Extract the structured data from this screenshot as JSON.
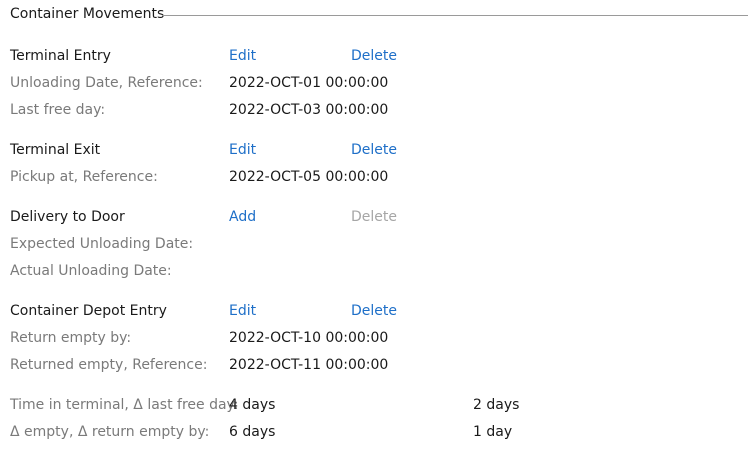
{
  "section": {
    "title": "Container Movements"
  },
  "terminal_entry": {
    "heading": "Terminal Entry",
    "edit_label": "Edit",
    "delete_label": "Delete",
    "unloading_label": "Unloading Date, Reference:",
    "unloading_value": "2022-OCT-01 00:00:00",
    "last_free_day_label": "Last free day:",
    "last_free_day_value": "2022-OCT-03 00:00:00"
  },
  "terminal_exit": {
    "heading": "Terminal Exit",
    "edit_label": "Edit",
    "delete_label": "Delete",
    "pickup_label": "Pickup at, Reference:",
    "pickup_value": "2022-OCT-05 00:00:00"
  },
  "delivery_to_door": {
    "heading": "Delivery to Door",
    "add_label": "Add",
    "delete_label": "Delete",
    "expected_label": "Expected Unloading Date:",
    "actual_label": "Actual Unloading Date:"
  },
  "container_depot_entry": {
    "heading": "Container Depot Entry",
    "edit_label": "Edit",
    "delete_label": "Delete",
    "return_empty_by_label": "Return empty by:",
    "return_empty_by_value": "2022-OCT-10 00:00:00",
    "returned_empty_label": "Returned empty, Reference:",
    "returned_empty_value": "2022-OCT-11 00:00:00"
  },
  "summary": {
    "time_in_terminal_label": "Time in terminal, Δ last free day:",
    "time_in_terminal_value": "4 days",
    "delta_last_free_day_value": "2 days",
    "delta_empty_label": "Δ empty, Δ return empty by:",
    "delta_empty_value": "6 days",
    "delta_return_empty_by_value": "1 day"
  },
  "colors": {
    "link": "#1e6fc8",
    "link_disabled": "#a6a6a6",
    "label": "#7a7a7a",
    "text": "#1a1a1a"
  }
}
